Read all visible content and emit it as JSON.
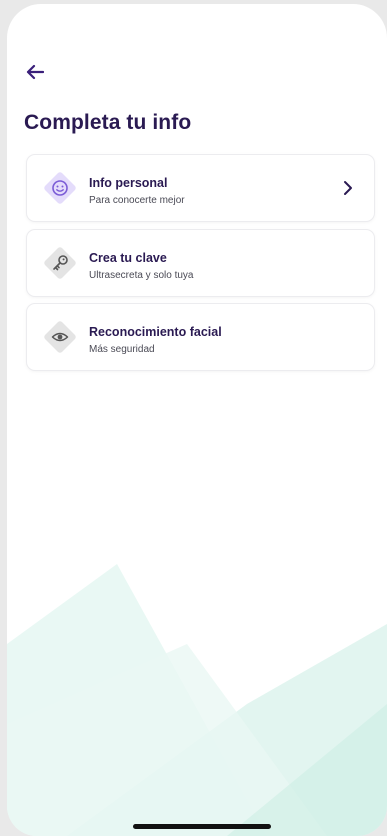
{
  "header": {
    "back_icon": "arrow-left-icon",
    "title": "Completa tu info"
  },
  "cards": [
    {
      "title": "Info personal",
      "subtitle": "Para conocerte mejor",
      "icon": "smiley-face-icon",
      "icon_bg": "#e4dcfb",
      "icon_color": "#7b5cd6",
      "enabled": true,
      "trailing_icon": "chevron-right-icon"
    },
    {
      "title": "Crea tu clave",
      "subtitle": "Ultrasecreta y solo tuya",
      "icon": "key-icon",
      "icon_bg": "#e4e4e4",
      "icon_color": "#555555",
      "enabled": false
    },
    {
      "title": "Reconocimiento facial",
      "subtitle": "Más seguridad",
      "icon": "eye-icon",
      "icon_bg": "#e4e4e4",
      "icon_color": "#555555",
      "enabled": false
    }
  ],
  "colors": {
    "primary_text": "#2a1a52",
    "accent": "#6c3fd1",
    "background_tint": "#dff4ee"
  }
}
